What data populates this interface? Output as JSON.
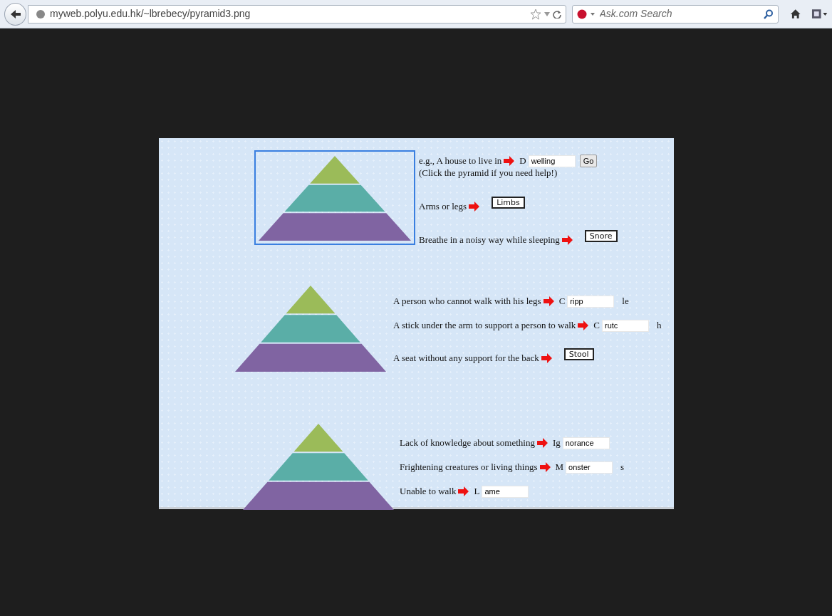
{
  "browser": {
    "url": "myweb.polyu.edu.hk/~lbrebecy/pyramid3.png",
    "search_placeholder": "Ask.com Search"
  },
  "sections": [
    {
      "outlined": true,
      "rows": [
        {
          "kind": "fill",
          "prompt": "e.g., A house to live in",
          "prefix": "D",
          "value": "welling",
          "suffix": "",
          "button": "Go",
          "note": "(Click the pyramid if you need help!)"
        },
        {
          "kind": "answer",
          "prompt": "Arms or legs",
          "answer": "Limbs"
        },
        {
          "kind": "answer",
          "prompt": "Breathe in a noisy way while sleeping",
          "answer": "Snore"
        }
      ]
    },
    {
      "outlined": false,
      "rows": [
        {
          "kind": "fill",
          "prompt": "A person who cannot walk with his legs",
          "prefix": "C",
          "value": "ripp",
          "suffix": "le"
        },
        {
          "kind": "fill",
          "prompt": "A stick under the arm to support a person to walk",
          "prefix": "C",
          "value": "rutc",
          "suffix": "h"
        },
        {
          "kind": "answer",
          "prompt": "A seat without any support for the back",
          "answer": "Stool"
        }
      ]
    },
    {
      "outlined": false,
      "rows": [
        {
          "kind": "fill",
          "prompt": "Lack of knowledge about something",
          "prefix": "Ig",
          "value": "norance",
          "suffix": ""
        },
        {
          "kind": "fill",
          "prompt": "Frightening creatures or living things",
          "prefix": "M",
          "value": "onster",
          "suffix": "s"
        },
        {
          "kind": "fill",
          "prompt": "Unable to walk",
          "prefix": "L",
          "value": "ame",
          "suffix": ""
        }
      ]
    }
  ]
}
